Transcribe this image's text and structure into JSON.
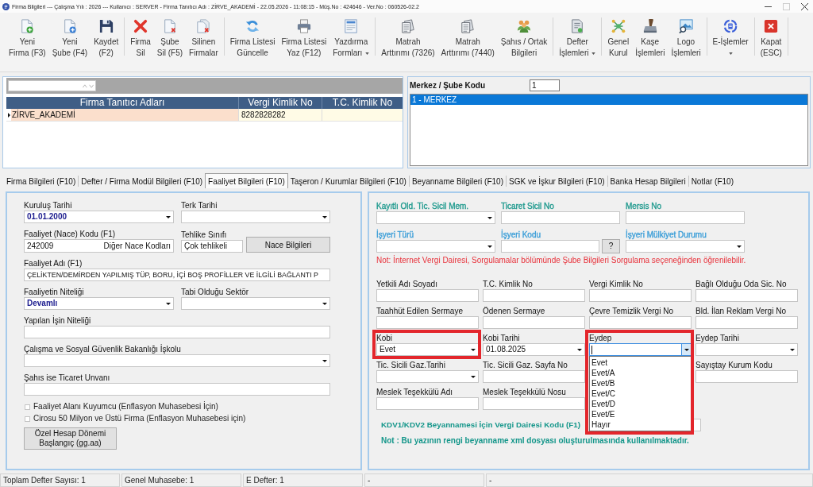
{
  "window": {
    "title": "Firma Bilgileri --- Çalışma Yılı : 2026 --- Kullanıcı : SERVER - Firma Tanıtıcı Adı : ZİRVE_AKADEMİ - 22.05.2026 - 11:08:15 - Müş.No : 424646 - Ver.No : 060526-02.2",
    "controls": [
      {
        "kind": "minimize",
        "disabled": false
      },
      {
        "kind": "maximize",
        "disabled": true
      },
      {
        "kind": "close",
        "disabled": false
      }
    ]
  },
  "toolbar": [
    [
      {
        "lines": [
          "Yeni",
          "Firma (F3)"
        ],
        "has_menu": false
      },
      {
        "lines": [
          "Yeni",
          "Şube (F4)"
        ],
        "has_menu": false
      },
      {
        "lines": [
          "Kaydet",
          "(F2)"
        ],
        "has_menu": false
      }
    ],
    [
      {
        "lines": [
          "Firma",
          "Sil"
        ],
        "has_menu": false
      },
      {
        "lines": [
          "Şube",
          "Sil (F5)"
        ],
        "has_menu": false
      },
      {
        "lines": [
          "Silinen",
          "Firmalar"
        ],
        "has_menu": false
      }
    ],
    [
      {
        "lines": [
          "Firma Listesi",
          "Güncelle"
        ],
        "has_menu": false
      },
      {
        "lines": [
          "Firma Listesi",
          "Yaz (F12)"
        ],
        "has_menu": false
      },
      {
        "lines": [
          "Yazdırma",
          "Formları"
        ],
        "has_menu": true
      }
    ],
    [
      {
        "lines": [
          "Matrah",
          "Arttırımı (7326)"
        ],
        "has_menu": false
      },
      {
        "lines": [
          "Matrah",
          "Arttırımı (7440)"
        ],
        "has_menu": false
      },
      {
        "lines": [
          "Şahıs / Ortak",
          "Bilgileri"
        ],
        "has_menu": false
      }
    ],
    [
      {
        "lines": [
          "Defter",
          "İşlemleri"
        ],
        "has_menu": true
      }
    ],
    [
      {
        "lines": [
          "Genel",
          "Kurul"
        ],
        "has_menu": false
      },
      {
        "lines": [
          "Kaşe",
          "İşlemleri"
        ],
        "has_menu": false
      },
      {
        "lines": [
          "Logo",
          "İşlemleri"
        ],
        "has_menu": false
      }
    ],
    [
      {
        "lines": [
          "E-İşlemler"
        ],
        "has_menu": true
      }
    ],
    [
      {
        "lines": [
          "Kapat",
          "(ESC)"
        ],
        "has_menu": false
      }
    ]
  ],
  "company_list": {
    "columns": [
      "Firma Tanıtıcı Adları",
      "Vergi Kimlik No",
      "T.C. Kimlik No"
    ],
    "rows": [
      {
        "cells": [
          "ZİRVE_AKADEMİ",
          "8282828282"
        ],
        "selected": true
      }
    ]
  },
  "branch": {
    "label": "Merkez / Şube Kodu",
    "code": "1",
    "items": [
      {
        "label": "1 - MERKEZ",
        "selected": true
      }
    ]
  },
  "tabs": [
    {
      "label": "Firma Bilgileri (F10)",
      "selected": false
    },
    {
      "label": "Defter / Firma Modül Bilgileri (F10)",
      "selected": false
    },
    {
      "label": "Faaliyet Bilgileri (F10)",
      "selected": true
    },
    {
      "label": "Taşeron / Kurumlar Bilgileri (F10)",
      "selected": false
    },
    {
      "label": "Beyanname Bilgileri (F10)",
      "selected": false
    },
    {
      "label": "SGK ve İşkur Bilgileri (F10)",
      "selected": false
    },
    {
      "label": "Banka Hesap Bilgileri",
      "selected": false
    },
    {
      "label": "Notlar (F10)",
      "selected": false
    }
  ],
  "activity": {
    "rows": [
      [
        {
          "kind": "combo",
          "label": "Kuruluş Tarihi",
          "value": "01.01.2000",
          "bold": true
        },
        {
          "kind": "combo",
          "label": "Terk Tarihi"
        }
      ],
      [
        {
          "kind": "code",
          "label": "Faaliyet (Nace) Kodu (F1)",
          "value": "242009",
          "bold": false,
          "action": "Diğer Nace Kodları"
        },
        {
          "kind": "text",
          "label": "Tehlike Sınıfı",
          "value": "Çok tehlikeli",
          "bold": false
        },
        {
          "kind": "button",
          "label": "Nace Bilgileri"
        }
      ],
      [
        {
          "kind": "text",
          "label": "Faaliyet Adı (F1)",
          "value": "ÇELİKTEN/DEMİRDEN YAPILMIŞ TÜP, BORU, İÇİ BOŞ PROFİLLER VE İLGİLİ BAĞLANTI P",
          "bold": false
        }
      ],
      [
        {
          "kind": "combo",
          "label": "Faaliyetin Niteliği",
          "value": "Devamlı",
          "bold": true
        },
        {
          "kind": "combo",
          "label": "Tabi Olduğu Sektör"
        }
      ],
      [
        {
          "kind": "text",
          "label": "Yapılan İşin Niteliği"
        }
      ],
      [
        {
          "kind": "combo",
          "label": "Çalışma ve Sosyal Güvenlik Bakanlığı İşkolu"
        }
      ],
      [
        {
          "kind": "text",
          "label": "Şahıs ise Ticaret Unvanı"
        }
      ]
    ],
    "checks": [
      {
        "label": "Faaliyet Alanı Kuyumcu (Enflasyon Muhasebesi İçin)",
        "checked": false
      },
      {
        "label": "Cirosu 50 Milyon ve Üstü Firma (Enflasyon Muhasebesi için)",
        "checked": false
      }
    ],
    "period_button": {
      "lines": [
        "Özel Hesap Dönemi",
        "Başlangıç (gg.aa)"
      ]
    }
  },
  "registry": {
    "rows": [
      [
        {
          "kind": "combo",
          "label": "Kayıtlı Old. Tic. Sicil Mem.",
          "color": "#1f9a8e"
        },
        {
          "kind": "text",
          "label": "Ticaret Sicil No",
          "color": "#1f9a8e"
        },
        {
          "kind": "text",
          "label": "Mersis No",
          "color": "#1f9a8e"
        }
      ],
      [
        {
          "kind": "combo",
          "label": "İşyeri Türü",
          "color": "#3b9ed8"
        },
        {
          "kind": "lookup",
          "label": "İşyeri Kodu",
          "color": "#3b9ed8",
          "action": "?"
        },
        {
          "kind": "combo",
          "label": "İşyeri Mülkiyet Durumu",
          "color": "#3b9ed8"
        }
      ]
    ],
    "note": "Not: İnternet Vergi Dairesi, Sorgulamalar bölümünde Şube Bilgileri Sorgulama seçeneğinden öğrenilebilir."
  },
  "details": {
    "rows": [
      [
        {
          "kind": "text",
          "label": "Yetkili Adı Soyadı",
          "highlighted": false
        },
        {
          "kind": "text",
          "label": "T.C. Kimlik No",
          "highlighted": false
        },
        {
          "kind": "text",
          "label": "Vergi Kimlik No",
          "highlighted": false
        },
        {
          "kind": "text",
          "label": "Bağlı Olduğu Oda Sic. No",
          "highlighted": false
        }
      ],
      [
        {
          "kind": "text",
          "label": "Taahhüt Edilen Sermaye",
          "highlighted": false
        },
        {
          "kind": "text",
          "label": "Ödenen Sermaye",
          "highlighted": false
        },
        {
          "kind": "text",
          "label": "Çevre Temizlik Vergi No",
          "highlighted": false
        },
        {
          "kind": "text",
          "label": "Bld. İlan Reklam Vergi No",
          "highlighted": false
        }
      ],
      [
        {
          "kind": "combo",
          "label": "Kobi",
          "value": "Evet",
          "highlighted": true,
          "expanded": false
        },
        {
          "kind": "combo",
          "label": "Kobi Tarihi",
          "value": "01.08.2025",
          "highlighted": false,
          "expanded": false
        },
        {
          "kind": "combo",
          "label": "Eydep",
          "highlighted": true,
          "expanded": true,
          "options": [
            {
              "label": "Evet",
              "selected": false
            },
            {
              "label": "Evet/A",
              "selected": false
            },
            {
              "label": "Evet/B",
              "selected": false
            },
            {
              "label": "Evet/C",
              "selected": false
            },
            {
              "label": "Evet/D",
              "selected": false
            },
            {
              "label": "Evet/E",
              "selected": false
            },
            {
              "label": "Hayır",
              "selected": false
            }
          ]
        },
        {
          "kind": "combo",
          "label": "Eydep Tarihi",
          "highlighted": false,
          "expanded": false
        }
      ],
      [
        {
          "kind": "combo",
          "label": "Tic. Sicili Gaz.Tarihi",
          "highlighted": false,
          "expanded": false
        },
        {
          "kind": "text",
          "label": "Tic. Sicili Gaz. Sayfa No",
          "highlighted": false
        },
        "",
        {
          "kind": "text",
          "label": "Sayıştay Kurum Kodu",
          "highlighted": false
        }
      ],
      [
        {
          "kind": "text",
          "label": "Meslek Teşekkülü Adı",
          "highlighted": false
        },
        {
          "kind": "text",
          "label": "Meslek Teşekkülü Nosu",
          "highlighted": false
        }
      ]
    ],
    "tax_office": {
      "label": "KDV1/KDV2 Beyannamesi İçin Vergi Dairesi Kodu (F1)"
    },
    "footnote": "Not : Bu yazının rengi beyanname xml dosyası oluşturulmasında kullanılmaktadır."
  },
  "status_bar": [
    "Toplam Defter Sayısı: 1",
    "Genel Muhasebe: 1",
    "E Defter: 1",
    "-",
    "-"
  ]
}
